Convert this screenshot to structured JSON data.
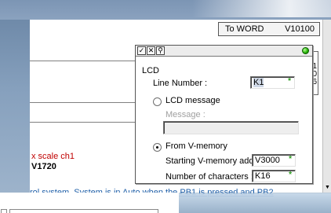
{
  "editor": {
    "to_word_label": "To WORD",
    "to_word_value": "V10100",
    "right_stub_values": [
      "1",
      "0",
      "6"
    ],
    "scale_label": "x scale ch1",
    "scale_value": "V1720",
    "status_prefix": "rol system. ",
    "status_link": "System is in Auto when the PB1 is pressed and PB2"
  },
  "lcd_dialog": {
    "title_icons": [
      "check-icon",
      "close-x-icon",
      "binoculars-icon"
    ],
    "section_title": "LCD",
    "line_number_label": "Line Number :",
    "line_number_value": "K1",
    "option_lcd_message": "LCD message",
    "message_label": "Message :",
    "message_value": "",
    "option_from_vmemory": "From V-memory",
    "start_address_label": "Starting V-memory address :",
    "start_address_value": "V3000",
    "num_chars_label": "Number of characters :",
    "num_chars_value": "K16",
    "selected_option": "From V-memory",
    "required_marker": "*",
    "status_led_color": "#22b000"
  },
  "colors": {
    "scale_label": "#c00000",
    "status_link": "#1f5fa8"
  }
}
